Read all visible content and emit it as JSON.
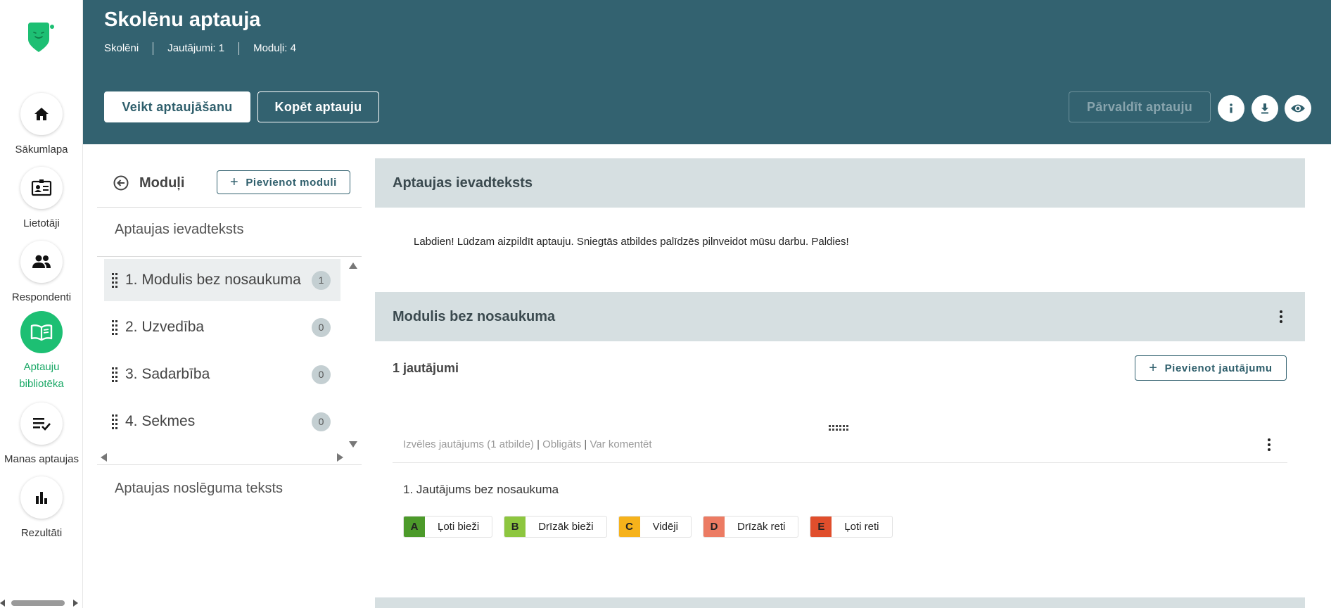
{
  "nav": {
    "items": [
      {
        "label": "Sākumlapa",
        "icon": "home-icon"
      },
      {
        "label": "Lietotāji",
        "icon": "id-card-icon"
      },
      {
        "label": "Respondenti",
        "icon": "people-icon"
      },
      {
        "label_line1": "Aptauju",
        "label_line2": "bibliotēka",
        "icon": "book-icon",
        "active": true
      },
      {
        "label": "Manas aptaujas",
        "icon": "checklist-icon"
      },
      {
        "label": "Rezultāti",
        "icon": "bar-chart-icon"
      }
    ]
  },
  "header": {
    "title": "Skolēnu aptauja",
    "meta": [
      "Skolēni",
      "Jautājumi: 1",
      "Moduļi: 4"
    ],
    "take_survey_label": "Veikt aptaujāšanu",
    "copy_survey_label": "Kopēt aptauju",
    "manage_survey_label": "Pārvaldīt aptauju"
  },
  "modules": {
    "title": "Moduļi",
    "add_module_label": "Pievienot moduli",
    "intro_label": "Aptaujas ievadteksts",
    "items": [
      {
        "label": "1. Modulis bez nosaukuma",
        "count": "1",
        "selected": true
      },
      {
        "label": "2. Uzvedība",
        "count": "0"
      },
      {
        "label": "3. Sadarbība",
        "count": "0"
      },
      {
        "label": "4. Sekmes",
        "count": "0"
      }
    ],
    "outro_label": "Aptaujas noslēguma teksts"
  },
  "content": {
    "intro_section_title": "Aptaujas ievadteksts",
    "intro_text": "Labdien! Lūdzam aizpildīt aptauju. Sniegtās atbildes palīdzēs pilnveidot mūsu darbu. Paldies!",
    "module_section_title": "Modulis bez nosaukuma",
    "question_count": "1 jautājumi",
    "add_question_label": "Pievienot jautājumu",
    "question": {
      "type": "Izvēles jautājums (1 atbilde)",
      "required": "Obligāts",
      "comment": "Var komentēt",
      "title": "1. Jautājums bez nosaukuma",
      "options": [
        {
          "key": "A",
          "label": "Ļoti bieži",
          "color": "#4c9a2a"
        },
        {
          "key": "B",
          "label": "Drīzāk bieži",
          "color": "#8dc63f"
        },
        {
          "key": "C",
          "label": "Vidēji",
          "color": "#f6b21b"
        },
        {
          "key": "D",
          "label": "Drīzāk reti",
          "color": "#ec7b63"
        },
        {
          "key": "E",
          "label": "Ļoti reti",
          "color": "#e04e2c"
        }
      ]
    }
  },
  "colors": {
    "header_bg": "#336270",
    "accent_green": "#1dbf73",
    "section_bg": "#d6dfe1"
  }
}
